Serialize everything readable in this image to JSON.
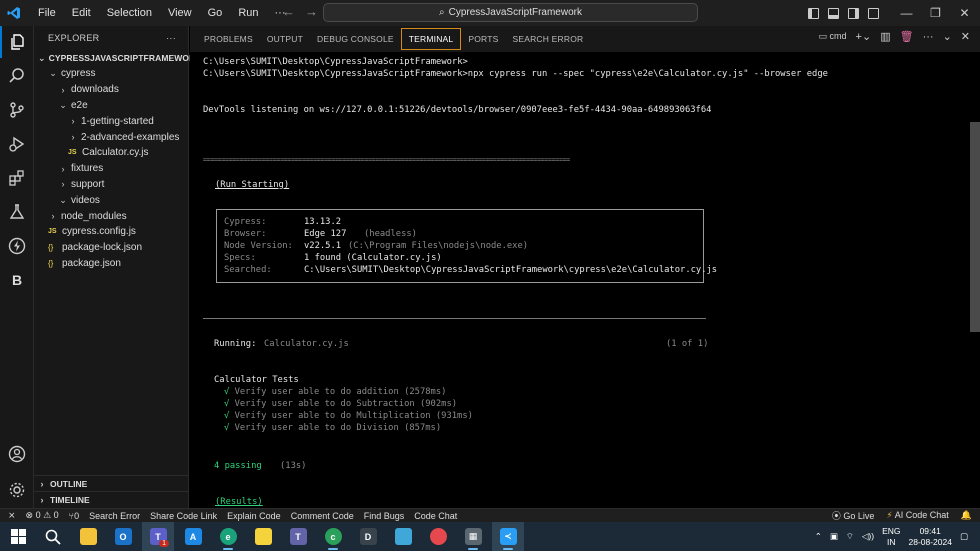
{
  "titlebar": {
    "menus": [
      "File",
      "Edit",
      "Selection",
      "View",
      "Go",
      "Run",
      "···"
    ],
    "search_text": "CypressJavaScriptFramework"
  },
  "activity": {
    "items": [
      "explorer-icon",
      "search-icon",
      "source-control-icon",
      "run-debug-icon",
      "extensions-icon",
      "testing-icon",
      "lightning-icon",
      "b-icon"
    ],
    "bottom": [
      "account-icon",
      "settings-icon"
    ]
  },
  "sidebar": {
    "header": "EXPLORER",
    "more": "···",
    "tree": [
      {
        "label": "CYPRESSJAVASCRIPTFRAMEWORK",
        "depth": 0,
        "kind": "root",
        "chev": "⌄"
      },
      {
        "label": "cypress",
        "depth": 1,
        "kind": "folder",
        "chev": "⌄"
      },
      {
        "label": "downloads",
        "depth": 2,
        "kind": "folder",
        "chev": "›"
      },
      {
        "label": "e2e",
        "depth": 2,
        "kind": "folder",
        "chev": "⌄"
      },
      {
        "label": "1-getting-started",
        "depth": 3,
        "kind": "folder",
        "chev": "›"
      },
      {
        "label": "2-advanced-examples",
        "depth": 3,
        "kind": "folder",
        "chev": "›"
      },
      {
        "label": "Calculator.cy.js",
        "depth": 3,
        "kind": "js",
        "chev": ""
      },
      {
        "label": "fixtures",
        "depth": 2,
        "kind": "folder",
        "chev": "›"
      },
      {
        "label": "support",
        "depth": 2,
        "kind": "folder",
        "chev": "›"
      },
      {
        "label": "videos",
        "depth": 2,
        "kind": "folder",
        "chev": "⌄"
      },
      {
        "label": "node_modules",
        "depth": 1,
        "kind": "folder",
        "chev": "›"
      },
      {
        "label": "cypress.config.js",
        "depth": 1,
        "kind": "js",
        "chev": ""
      },
      {
        "label": "package-lock.json",
        "depth": 1,
        "kind": "json",
        "chev": ""
      },
      {
        "label": "package.json",
        "depth": 1,
        "kind": "json",
        "chev": ""
      }
    ],
    "outline": "OUTLINE",
    "timeline": "TIMELINE"
  },
  "panel": {
    "tabs": [
      "PROBLEMS",
      "OUTPUT",
      "DEBUG CONSOLE",
      "TERMINAL",
      "PORTS",
      "SEARCH ERROR"
    ],
    "active_tab": "TERMINAL",
    "shell": "cmd"
  },
  "terminal": {
    "prompt1": "C:\\Users\\SUMIT\\Desktop\\CypressJavaScriptFramework>",
    "prompt2": "C:\\Users\\SUMIT\\Desktop\\CypressJavaScriptFramework>npx cypress run --spec \"cypress\\e2e\\Calculator.cy.js\" --browser edge",
    "devtools": "DevTools listening on ws://127.0.0.1:51226/devtools/browser/0907eee3-fe5f-4434-90aa-649893063f64",
    "separator": "====================================================================================================",
    "run_starting": "(Run Starting)",
    "info": {
      "cypress_label": "Cypress:",
      "cypress_value": "13.13.2",
      "browser_label": "Browser:",
      "browser_value": "Edge 127",
      "browser_note": "(headless)",
      "node_label": "Node Version:",
      "node_value": "v22.5.1",
      "node_note": "(C:\\Program Files\\nodejs\\node.exe)",
      "specs_label": "Specs:",
      "specs_value": "1 found (Calculator.cy.js)",
      "searched_label": "Searched:",
      "searched_value": "C:\\Users\\SUMIT\\Desktop\\CypressJavaScriptFramework\\cypress\\e2e\\Calculator.cy.js"
    },
    "running_label": "Running:",
    "running_file": "Calculator.cy.js",
    "running_count": "(1 of 1)",
    "suite": "Calculator Tests",
    "tests": [
      "√ Verify user able to do addition (2578ms)",
      "√ Verify user able to do Subtraction (902ms)",
      "√ Verify user able to do Multiplication (931ms)",
      "√ Verify user able to do Division (857ms)"
    ],
    "passing": "4 passing",
    "passing_time": "(13s)",
    "results": "(Results)"
  },
  "statusbar": {
    "errors": "⊗ 0 ⚠ 0",
    "ports": "⑂0",
    "items": [
      "Search Error",
      "Share Code Link",
      "Explain Code",
      "Comment Code",
      "Find Bugs",
      "Code Chat"
    ],
    "golive": "Go Live",
    "aichat": "AI Code Chat"
  },
  "taskbar": {
    "lang1": "ENG",
    "lang2": "IN",
    "time": "09:41",
    "date": "28-08-2024",
    "badge": "1"
  },
  "colors": {
    "accent": "#0078d4",
    "terminal_tab_border": "#d58a1c",
    "pass_green": "#2ed47a"
  }
}
